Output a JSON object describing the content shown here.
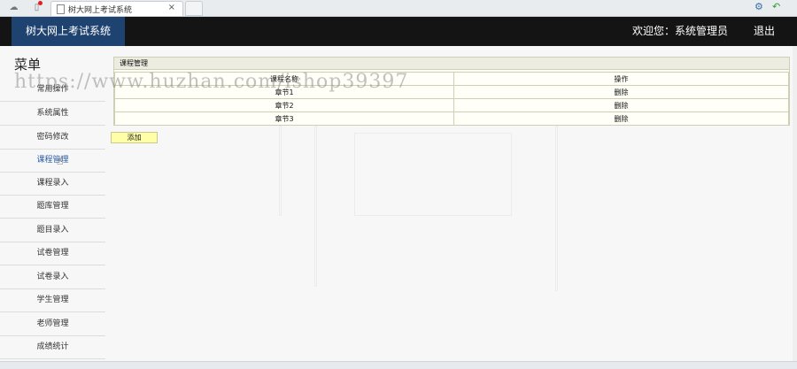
{
  "browser": {
    "tab_title": "树大网上考试系统",
    "tab_close": "×"
  },
  "header": {
    "brand": "树大网上考试系统",
    "welcome": "欢迎您：系统管理员",
    "logout": "退出"
  },
  "sidebar": {
    "title": "菜单",
    "items": [
      {
        "label": "常用操作"
      },
      {
        "label": "系统属性"
      },
      {
        "label": "密码修改"
      },
      {
        "label": "课程管理"
      },
      {
        "label": "课程录入"
      },
      {
        "label": "题库管理"
      },
      {
        "label": "题目录入"
      },
      {
        "label": "试卷管理"
      },
      {
        "label": "试卷录入"
      },
      {
        "label": "学生管理"
      },
      {
        "label": "老师管理"
      },
      {
        "label": "成绩统计"
      }
    ]
  },
  "main": {
    "panel_title": "课程管理",
    "columns": [
      "课程名称",
      "操作"
    ],
    "rows": [
      {
        "name": "章节1",
        "action": "删除"
      },
      {
        "name": "章节2",
        "action": "删除"
      },
      {
        "name": "章节3",
        "action": "删除"
      }
    ],
    "add_label": "添加"
  },
  "watermark": "https://www.huzhan.com/ishop39397"
}
